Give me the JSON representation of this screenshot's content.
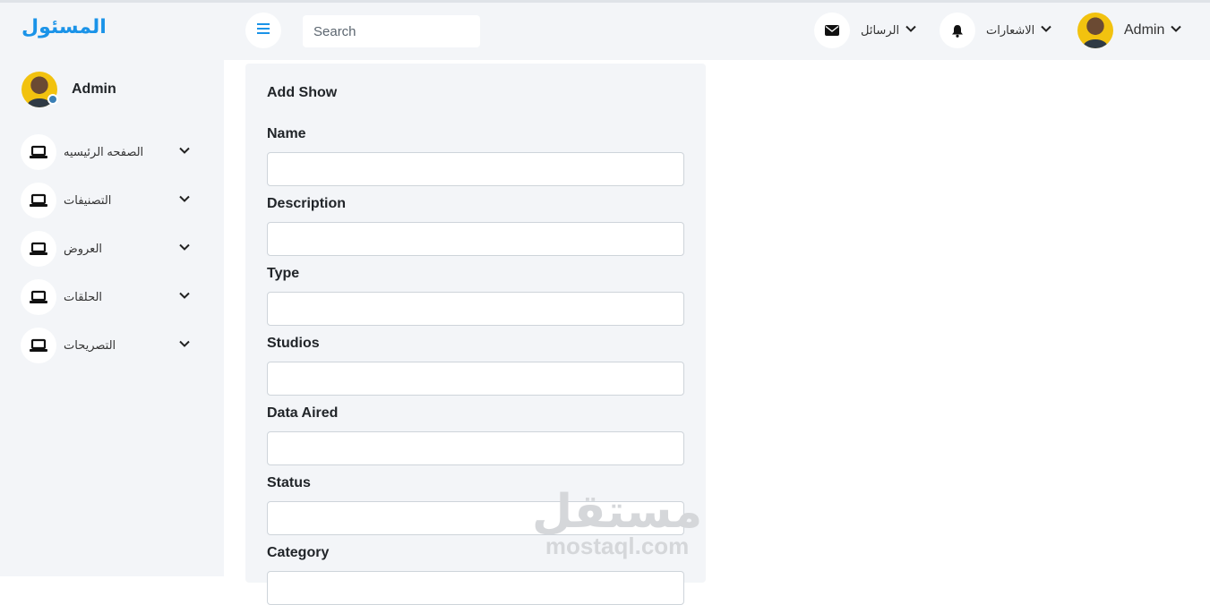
{
  "sidebar": {
    "brand": "المسئول",
    "profile_name": "Admin",
    "items": [
      {
        "label": "الصفحه الرئيسيه",
        "icon": "laptop-icon"
      },
      {
        "label": "التصنيفات",
        "icon": "laptop-icon"
      },
      {
        "label": "العروض",
        "icon": "laptop-icon"
      },
      {
        "label": "الحلقات",
        "icon": "laptop-icon"
      },
      {
        "label": "التصريحات",
        "icon": "laptop-icon"
      }
    ]
  },
  "header": {
    "menu_icon": "bars-icon",
    "search_placeholder": "Search",
    "messages_label": "الرسائل",
    "messages_icon": "envelope-icon",
    "notifications_label": "الاشعارات",
    "notifications_icon": "bell-icon",
    "user_name": "Admin"
  },
  "form": {
    "title": "Add Show",
    "fields": [
      {
        "label": "Name",
        "value": ""
      },
      {
        "label": "Description",
        "value": ""
      },
      {
        "label": "Type",
        "value": ""
      },
      {
        "label": "Studios",
        "value": ""
      },
      {
        "label": "Data Aired",
        "value": ""
      },
      {
        "label": "Status",
        "value": ""
      },
      {
        "label": "Category",
        "value": ""
      }
    ]
  },
  "watermark": {
    "arabic": "مستقل",
    "latin": "mostaql.com"
  },
  "colors": {
    "brand": "#1a93e8",
    "panel": "#f3f5f8",
    "text": "#212529"
  }
}
